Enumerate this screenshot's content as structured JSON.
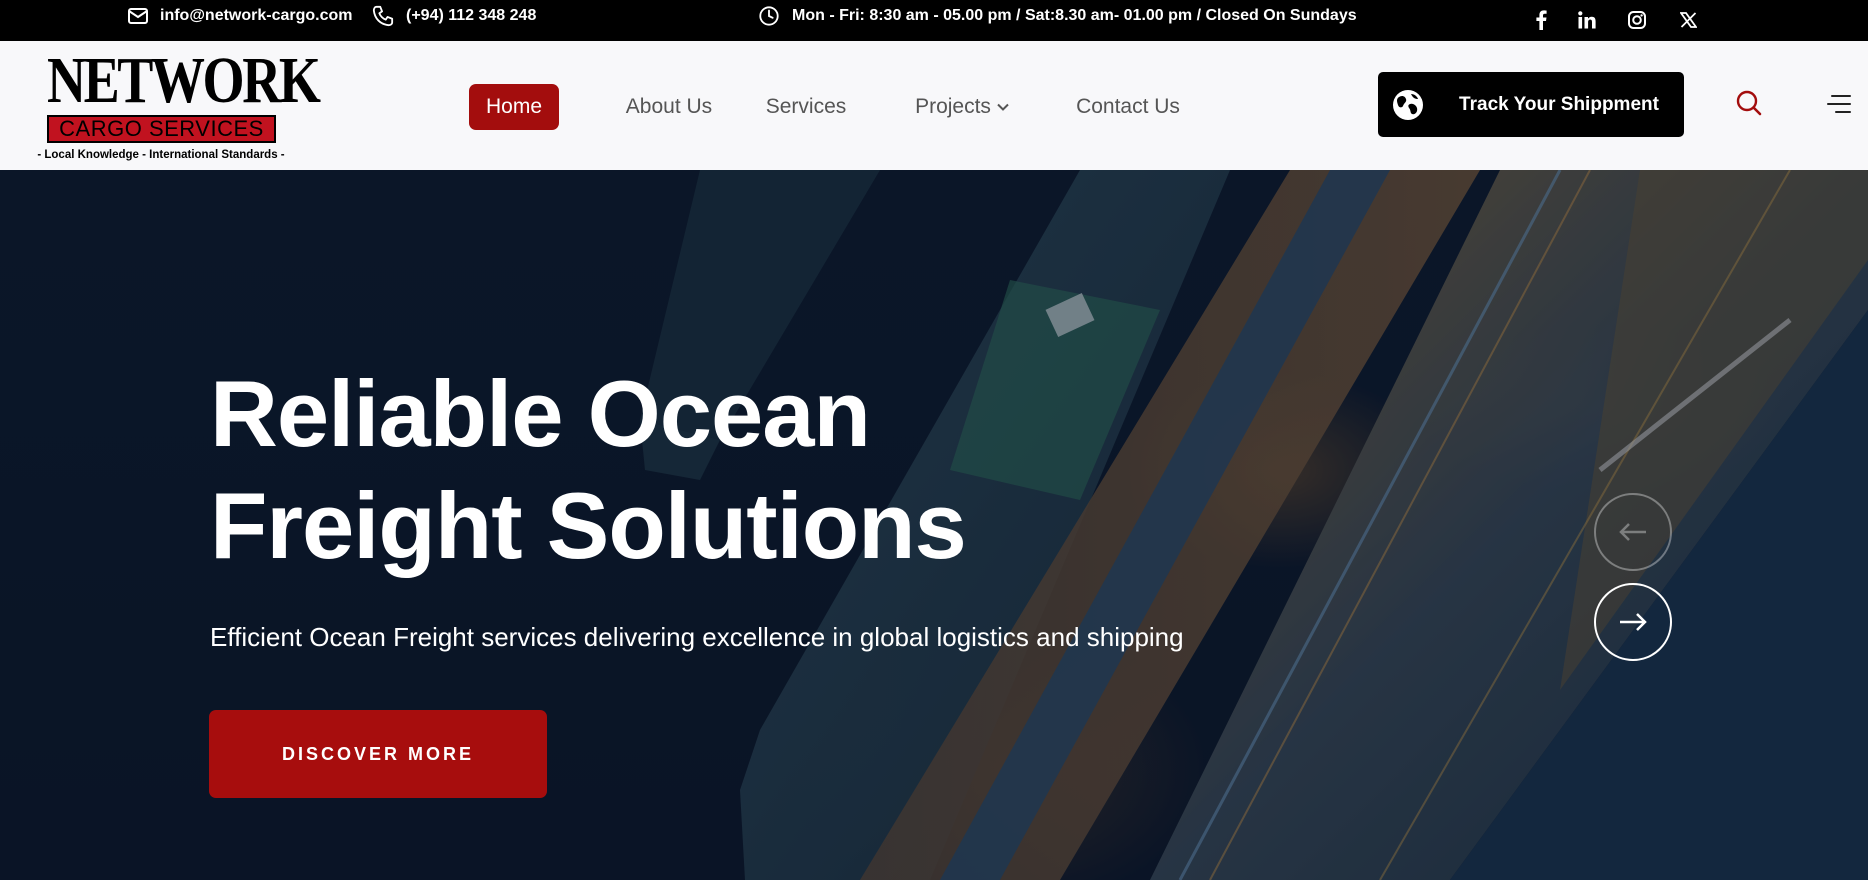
{
  "topbar": {
    "email": "info@network-cargo.com",
    "phone": "(+94) 112 348 248",
    "hours": "Mon - Fri: 8:30 am - 05.00 pm / Sat:8.30 am- 01.00 pm / Closed On Sundays",
    "icons": [
      "mail-icon",
      "phone-icon",
      "clock-icon"
    ],
    "social": [
      "facebook-icon",
      "linkedin-icon",
      "instagram-icon",
      "x-icon"
    ]
  },
  "logo": {
    "title": "NETWORK",
    "subtitle": "CARGO SERVICES",
    "tagline": "- Local Knowledge - International Standards -"
  },
  "nav": {
    "home": "Home",
    "about": "About Us",
    "services": "Services",
    "projects": "Projects",
    "contact": "Contact Us"
  },
  "header": {
    "track_label": "Track Your Shippment",
    "icons": [
      "globe-icon",
      "search-icon",
      "menu-icon"
    ]
  },
  "hero": {
    "title_line1": "Reliable Ocean",
    "title_line2": "Freight Solutions",
    "subtitle": "Efficient Ocean Freight services delivering excellence in global logistics and shipping",
    "cta": "DISCOVER MORE",
    "icons": [
      "arrow-left-icon",
      "arrow-right-icon"
    ]
  },
  "colors": {
    "accent": "#a30d0d",
    "topbar_bg": "#000000",
    "header_bg": "#f8f8fa",
    "hero_bg": "#0b1628"
  }
}
